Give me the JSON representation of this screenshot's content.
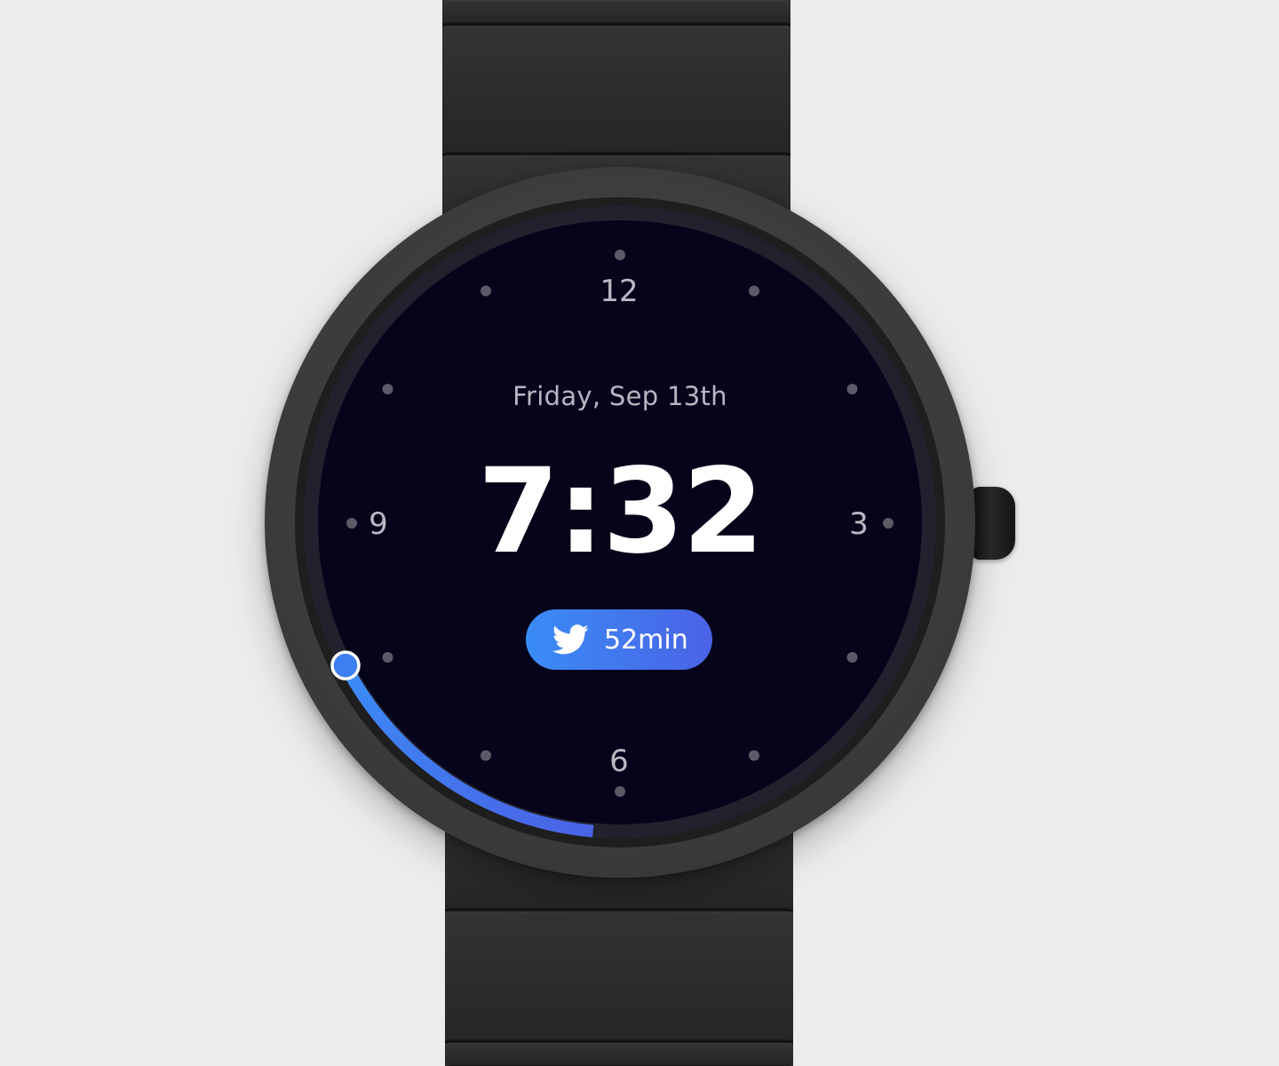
{
  "watch": {
    "date": "Friday, Sep 13th",
    "time": "7:32",
    "numerals": {
      "twelve": "12",
      "three": "3",
      "six": "6",
      "nine": "9"
    },
    "complication": {
      "icon": "twitter-bird-icon",
      "label": "52min"
    },
    "progress_fraction": 0.16
  },
  "colors": {
    "background": "#ececec",
    "dial": "#05041a",
    "accent_start": "#3a8cf5",
    "accent_end": "#4a63e6",
    "text_primary": "#ffffff",
    "text_secondary": "#b7b7c2"
  }
}
